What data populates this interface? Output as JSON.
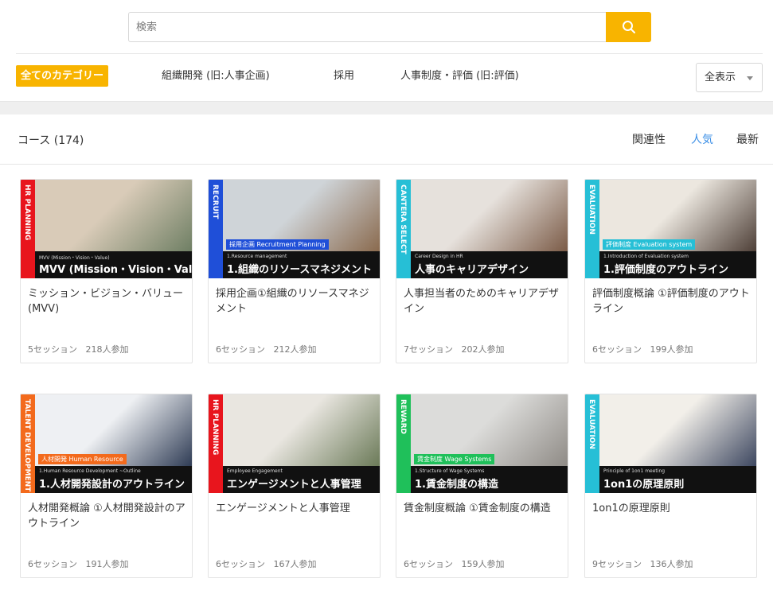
{
  "search": {
    "placeholder": "検索"
  },
  "categories": [
    {
      "label": "全てのカテゴリー"
    },
    {
      "label": "組織開発 (旧:人事企画)"
    },
    {
      "label": "採用"
    },
    {
      "label": "人事制度・評価 (旧:評価)"
    }
  ],
  "view_select": {
    "value": "全表示"
  },
  "courses_header": {
    "count_label": "コース (174)"
  },
  "sort": [
    {
      "label": "関連性"
    },
    {
      "label": "人気"
    },
    {
      "label": "最新"
    }
  ],
  "colors": {
    "accent": "#f8b400",
    "active_sort": "#3a8ee6",
    "stripe_red": "#e8151d",
    "stripe_blue": "#1f4fd8",
    "stripe_cyan": "#26bfd6",
    "stripe_orange": "#f36a1c",
    "stripe_green": "#1fc05a"
  },
  "cards": [
    {
      "stripe": "HR PLANNING",
      "stripe_color": "#e8151d",
      "tag": "",
      "tag_color": "",
      "banner_sub": "MVV (Mission・Vision・Value)",
      "banner_title": "MVV (Mission・Vision・Value)",
      "title": "ミッション・ビジョン・バリュー (MVV)",
      "sessions": "5セッション",
      "participants": "218人参加",
      "photo_a": "#d9cbb8",
      "photo_b": "#6f7f64"
    },
    {
      "stripe": "RECRUIT",
      "stripe_color": "#1f4fd8",
      "tag": "採用企画 Recruitment Planning",
      "tag_color": "#1f4fd8",
      "banner_sub": "1.Resource management",
      "banner_title": "1.組織のリソースマネジメント",
      "title": "採用企画①組織のリソースマネジメント",
      "sessions": "6セッション",
      "participants": "212人参加",
      "photo_a": "#cfd4d8",
      "photo_b": "#8a6a4e"
    },
    {
      "stripe": "CANTERA SELECT",
      "stripe_color": "#26bfd6",
      "tag": "",
      "tag_color": "",
      "banner_sub": "Career Design in HR",
      "banner_title": "人事のキャリアデザイン",
      "title": "人事担当者のためのキャリアデザイン",
      "sessions": "7セッション",
      "participants": "202人参加",
      "photo_a": "#e6e1dc",
      "photo_b": "#7b5b47"
    },
    {
      "stripe": "EVALUATION",
      "stripe_color": "#26bfd6",
      "tag": "評価制度 Evaluation system",
      "tag_color": "#26bfd6",
      "banner_sub": "1.Introduction of Evaluation system",
      "banner_title": "1.評価制度のアウトライン",
      "title": "評価制度概論 ①評価制度のアウトライン",
      "sessions": "6セッション",
      "participants": "199人参加",
      "photo_a": "#ece7df",
      "photo_b": "#4e3f37"
    },
    {
      "stripe": "TALENT DEVELOPMENT",
      "stripe_color": "#f36a1c",
      "tag": "人材開発 Human Resource",
      "tag_color": "#f36a1c",
      "banner_sub": "1.Human Resource Development ~Outline",
      "banner_title": "1.人材開発設計のアウトライン",
      "title": "人材開発概論 ①人材開発設計のアウトライン",
      "sessions": "6セッション",
      "participants": "191人参加",
      "photo_a": "#eef0f3",
      "photo_b": "#2f3c55"
    },
    {
      "stripe": "HR PLANNING",
      "stripe_color": "#e8151d",
      "tag": "",
      "tag_color": "",
      "banner_sub": "Employee Engagement",
      "banner_title": "エンゲージメントと人事管理",
      "title": "エンゲージメントと人事管理",
      "sessions": "6セッション",
      "participants": "167人参加",
      "photo_a": "#e9e6e0",
      "photo_b": "#6b7a58"
    },
    {
      "stripe": "REWARD",
      "stripe_color": "#1fc05a",
      "tag": "賃金制度 Wage Systems",
      "tag_color": "#1fc05a",
      "banner_sub": "1.Structure of Wage Systems",
      "banner_title": "1.賃金制度の構造",
      "title": "賃金制度概論 ①賃金制度の構造",
      "sessions": "6セッション",
      "participants": "159人参加",
      "photo_a": "#dcdcda",
      "photo_b": "#8f8b86"
    },
    {
      "stripe": "EVALUATION",
      "stripe_color": "#26bfd6",
      "tag": "",
      "tag_color": "",
      "banner_sub": "Principle of 1on1 meeting",
      "banner_title": "1on1の原理原則",
      "title": "1on1の原理原則",
      "sessions": "9セッション",
      "participants": "136人参加",
      "photo_a": "#f2efe9",
      "photo_b": "#3d4760"
    }
  ]
}
